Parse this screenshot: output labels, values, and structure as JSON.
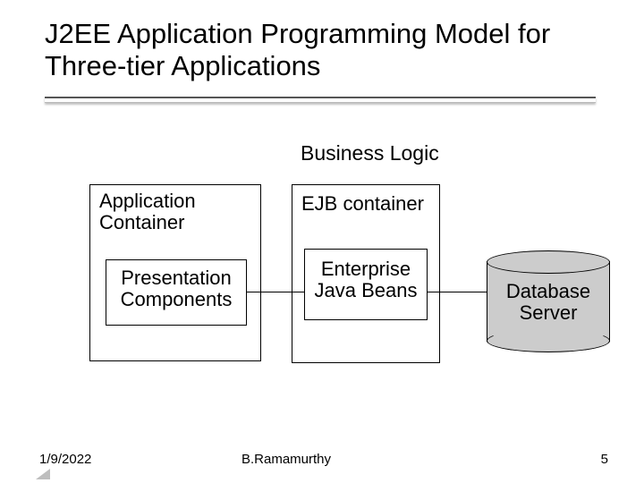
{
  "title": "J2EE Application Programming Model for Three-tier Applications",
  "section_label": "Business Logic",
  "containers": {
    "app": {
      "label": "Application\nContainer"
    },
    "ejb": {
      "label": "EJB container"
    }
  },
  "components": {
    "presentation": {
      "label": "Presentation\nComponents"
    },
    "ejb_beans": {
      "label": "Enterprise\nJava Beans"
    },
    "database": {
      "label": "Database\nServer"
    }
  },
  "footer": {
    "date": "1/9/2022",
    "author": "B.Ramamurthy",
    "slide_number": "5"
  },
  "chart_data": {
    "type": "diagram",
    "title": "J2EE Application Programming Model for Three-tier Applications",
    "nodes": [
      {
        "id": "app_container",
        "label": "Application Container",
        "kind": "container"
      },
      {
        "id": "presentation",
        "label": "Presentation Components",
        "kind": "component",
        "parent": "app_container"
      },
      {
        "id": "ejb_container",
        "label": "EJB container",
        "kind": "container",
        "group": "Business Logic"
      },
      {
        "id": "ejb_beans",
        "label": "Enterprise Java Beans",
        "kind": "component",
        "parent": "ejb_container"
      },
      {
        "id": "database",
        "label": "Database Server",
        "kind": "datastore"
      }
    ],
    "edges": [
      {
        "from": "presentation",
        "to": "ejb_beans"
      },
      {
        "from": "ejb_beans",
        "to": "database"
      }
    ]
  }
}
